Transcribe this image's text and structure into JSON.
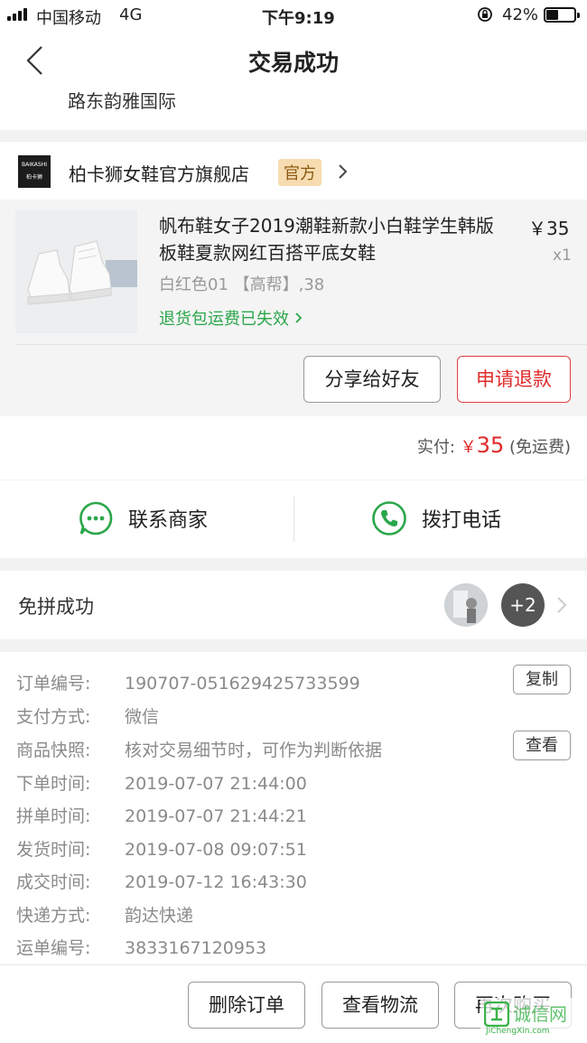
{
  "status_bar": {
    "carrier": "中国移动",
    "network": "4G",
    "time": "下午9:19",
    "battery": "42%",
    "battery_level": 0.42
  },
  "header": {
    "title": "交易成功",
    "address": "路东韵雅国际"
  },
  "shop": {
    "logo_text": "BAIKASHI",
    "logo_sub": "柏卡狮",
    "name": "柏卡狮女鞋官方旗舰店",
    "badge": "官方"
  },
  "product": {
    "name": "帆布鞋女子2019潮鞋新款小白鞋学生韩版板鞋夏款网红百搭平底女鞋",
    "price": "￥35",
    "qty": "x1",
    "spec": "白红色01 【高帮】,38",
    "refund_note": "退货包运费已失效",
    "share_label": "分享给好友",
    "refund_label": "申请退款"
  },
  "payment": {
    "label": "实付:",
    "currency": "￥",
    "amount": "35",
    "note": "(免运费)"
  },
  "contact": {
    "merchant_label": "联系商家",
    "phone_label": "拨打电话"
  },
  "group": {
    "title": "免拼成功",
    "extra_count": "+2"
  },
  "order_info": {
    "rows": [
      {
        "key": "订单编号:",
        "value": "190707-051629425733599"
      },
      {
        "key": "支付方式:",
        "value": "微信"
      },
      {
        "key": "商品快照:",
        "value": "核对交易细节时，可作为判断依据"
      },
      {
        "key": "下单时间:",
        "value": "2019-07-07 21:44:00"
      },
      {
        "key": "拼单时间:",
        "value": "2019-07-07 21:44:21"
      },
      {
        "key": "发货时间:",
        "value": "2019-07-08 09:07:51"
      },
      {
        "key": "成交时间:",
        "value": "2019-07-12 16:43:30"
      },
      {
        "key": "快递方式:",
        "value": "韵达快递"
      },
      {
        "key": "运单编号:",
        "value": "3833167120953"
      }
    ],
    "copy_label": "复制",
    "view_label": "查看"
  },
  "bottom": {
    "delete_label": "删除订单",
    "logistics_label": "查看物流",
    "rebuy_label": "再次购买"
  },
  "watermark": {
    "text": "诚信网",
    "sub": "JiChengXin.com"
  },
  "colors": {
    "red": "#e02a2a",
    "green": "#2aa64a",
    "badge_bg": "#f6dcb0"
  }
}
